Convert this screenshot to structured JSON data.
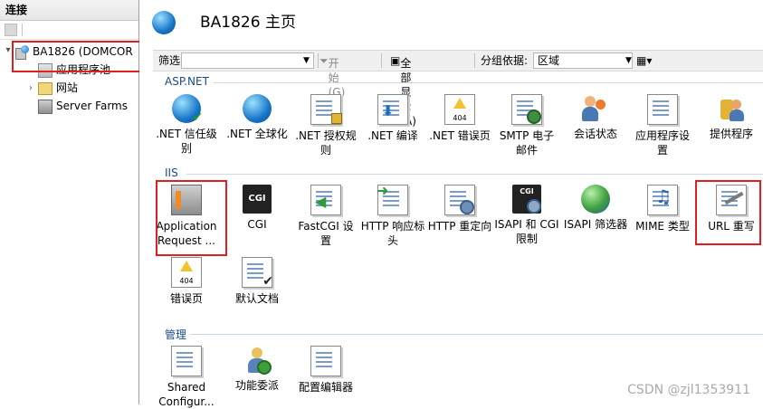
{
  "left_panel": {
    "header": "连接",
    "tree": [
      {
        "label": "BA1826 (DOMCOR",
        "expanded": true,
        "icon": "server-icon"
      },
      {
        "label": "应用程序池",
        "icon": "app-pool-icon"
      },
      {
        "label": "网站",
        "icon": "sites-folder-icon"
      },
      {
        "label": "Server Farms",
        "icon": "server-farms-icon"
      }
    ]
  },
  "header": {
    "title": "BA1826 主页"
  },
  "filter_bar": {
    "filter_label": "筛选:",
    "filter_value": "",
    "start_label": "开始(G)",
    "show_all_label": "全部显示(A)",
    "group_by_label": "分组依据:",
    "group_by_value": "区域"
  },
  "sections": {
    "aspnet": {
      "title": "ASP.NET",
      "items": [
        {
          "label": ".NET 信任级\n别",
          "icon": "trust-globe-check-icon"
        },
        {
          "label": ".NET 全球化",
          "icon": "globe-icon"
        },
        {
          "label": ".NET 授权规\n则",
          "icon": "authorization-lock-icon"
        },
        {
          "label": ".NET 编译",
          "icon": "compile-icon"
        },
        {
          "label": ".NET 错误页",
          "icon": "error-page-404-icon"
        },
        {
          "label": "SMTP 电子\n邮件",
          "icon": "smtp-email-icon"
        },
        {
          "label": "会话状态",
          "icon": "session-state-icon"
        },
        {
          "label": "应用程序设\n置",
          "icon": "app-settings-icon"
        },
        {
          "label": "提供程序",
          "icon": "providers-icon"
        }
      ]
    },
    "iis": {
      "title": "IIS",
      "items": [
        {
          "label": "Application\nRequest ...",
          "icon": "arr-server-icon"
        },
        {
          "label": "CGI",
          "icon": "cgi-icon"
        },
        {
          "label": "FastCGI 设\n置",
          "icon": "fastcgi-icon"
        },
        {
          "label": "HTTP 响应标\n头",
          "icon": "http-headers-icon"
        },
        {
          "label": "HTTP 重定向",
          "icon": "http-redirect-icon"
        },
        {
          "label": "ISAPI 和 CGI\n限制",
          "icon": "isapi-cgi-icon"
        },
        {
          "label": "ISAPI 筛选器",
          "icon": "isapi-filter-icon"
        },
        {
          "label": "MIME 类型",
          "icon": "mime-types-icon"
        },
        {
          "label": "URL 重写",
          "icon": "url-rewrite-icon"
        },
        {
          "label": "错误页",
          "icon": "error-page-404-icon"
        },
        {
          "label": "默认文档",
          "icon": "default-document-icon"
        }
      ]
    },
    "management": {
      "title": "管理",
      "items": [
        {
          "label": "Shared\nConfigur...",
          "icon": "shared-config-icon"
        },
        {
          "label": "功能委派",
          "icon": "feature-delegation-icon"
        },
        {
          "label": "配置编辑器",
          "icon": "config-editor-icon"
        }
      ]
    }
  },
  "watermark": "CSDN @zjl1353911"
}
